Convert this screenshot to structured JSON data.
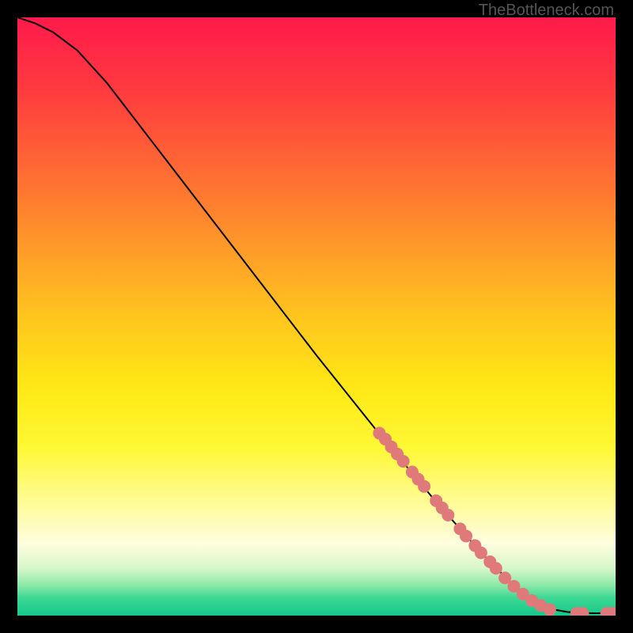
{
  "watermark": "TheBottleneck.com",
  "chart_data": {
    "type": "line",
    "title": "",
    "xlabel": "",
    "ylabel": "",
    "xlim": [
      0,
      100
    ],
    "ylim": [
      0,
      100
    ],
    "gradient_stops": [
      {
        "offset": 0.0,
        "color": "#ff1a4b"
      },
      {
        "offset": 0.12,
        "color": "#ff3a3f"
      },
      {
        "offset": 0.3,
        "color": "#ff7a30"
      },
      {
        "offset": 0.5,
        "color": "#ffc51e"
      },
      {
        "offset": 0.62,
        "color": "#ffe815"
      },
      {
        "offset": 0.72,
        "color": "#fff835"
      },
      {
        "offset": 0.82,
        "color": "#fffca0"
      },
      {
        "offset": 0.88,
        "color": "#fffde0"
      },
      {
        "offset": 0.92,
        "color": "#d8f8c8"
      },
      {
        "offset": 0.95,
        "color": "#8be8a8"
      },
      {
        "offset": 0.97,
        "color": "#3dd895"
      },
      {
        "offset": 1.0,
        "color": "#15c98a"
      }
    ],
    "curve": [
      [
        0,
        100
      ],
      [
        3,
        99
      ],
      [
        6,
        97.5
      ],
      [
        10,
        94.5
      ],
      [
        15,
        89
      ],
      [
        20,
        82.5
      ],
      [
        30,
        69.5
      ],
      [
        40,
        56.5
      ],
      [
        50,
        43.5
      ],
      [
        60,
        31
      ],
      [
        70,
        19
      ],
      [
        78,
        10
      ],
      [
        84,
        4
      ],
      [
        88,
        1.3
      ],
      [
        92,
        0.6
      ],
      [
        96,
        0.4
      ],
      [
        100,
        0.4
      ]
    ],
    "markers": {
      "color": "#e07a7a",
      "radius_px": 8,
      "points": [
        [
          60.5,
          30.5
        ],
        [
          61.5,
          29.5
        ],
        [
          62.5,
          28.2
        ],
        [
          63.5,
          27.0
        ],
        [
          64.5,
          25.8
        ],
        [
          66.0,
          24.0
        ],
        [
          67.0,
          22.8
        ],
        [
          68.0,
          21.6
        ],
        [
          70.0,
          19.2
        ],
        [
          71.0,
          18.0
        ],
        [
          72.0,
          16.8
        ],
        [
          74.0,
          14.5
        ],
        [
          75.0,
          13.3
        ],
        [
          76.5,
          11.7
        ],
        [
          77.5,
          10.5
        ],
        [
          79.0,
          9.0
        ],
        [
          80.0,
          7.9
        ],
        [
          81.5,
          6.3
        ],
        [
          83.0,
          4.9
        ],
        [
          84.5,
          3.6
        ],
        [
          86.0,
          2.5
        ],
        [
          87.5,
          1.7
        ],
        [
          89.0,
          1.0
        ],
        [
          93.5,
          0.4
        ],
        [
          94.5,
          0.4
        ],
        [
          98.5,
          0.4
        ],
        [
          99.5,
          0.4
        ]
      ]
    }
  }
}
